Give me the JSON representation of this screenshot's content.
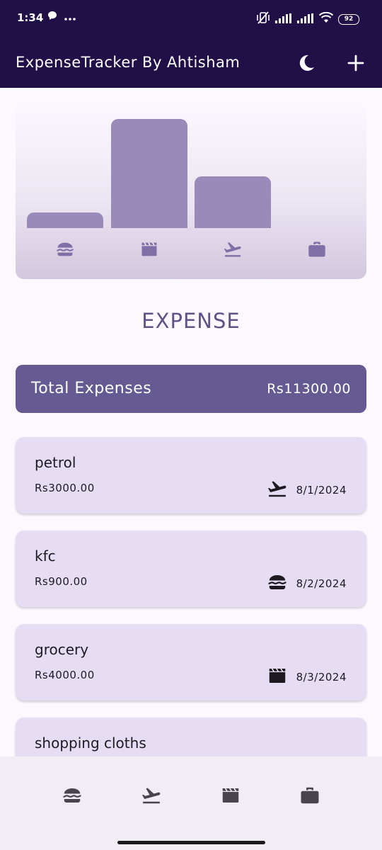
{
  "status_bar": {
    "time": "1:34",
    "battery": "92",
    "icons": [
      "chat-bubble-icon",
      "more-dots-icon",
      "vibrate-off-icon",
      "signal-icon",
      "signal-icon",
      "wifi-icon",
      "battery-icon"
    ]
  },
  "app_bar": {
    "title": "ExpenseTracker By Ahtisham",
    "actions": [
      "dark-mode-moon-icon",
      "add-plus-icon"
    ]
  },
  "chart_data": {
    "type": "bar",
    "categories": [
      "food",
      "leisure",
      "travel",
      "work"
    ],
    "values": [
      900,
      6300,
      3000,
      0
    ],
    "category_icons": [
      "burger-icon",
      "movie-clapper-icon",
      "flight-takeoff-icon",
      "briefcase-icon"
    ]
  },
  "section_title": "EXPENSE",
  "total": {
    "label": "Total Expenses",
    "value": "Rs11300.00"
  },
  "expenses": [
    {
      "title": "petrol",
      "amount": "Rs3000.00",
      "icon": "flight-takeoff-icon",
      "date": "8/1/2024"
    },
    {
      "title": "kfc",
      "amount": "Rs900.00",
      "icon": "burger-icon",
      "date": "8/2/2024"
    },
    {
      "title": "grocery",
      "amount": "Rs4000.00",
      "icon": "movie-clapper-icon",
      "date": "8/3/2024"
    },
    {
      "title": "shopping cloths",
      "amount": "",
      "icon": "",
      "date": ""
    }
  ],
  "bottom_nav": [
    "burger-icon",
    "flight-takeoff-icon",
    "movie-clapper-icon",
    "briefcase-icon"
  ],
  "colors": {
    "app_bar": "#211048",
    "accent": "#665a93",
    "bar": "#9a8ab9",
    "card": "#e6ddf5",
    "background": "#fcf8ff"
  }
}
